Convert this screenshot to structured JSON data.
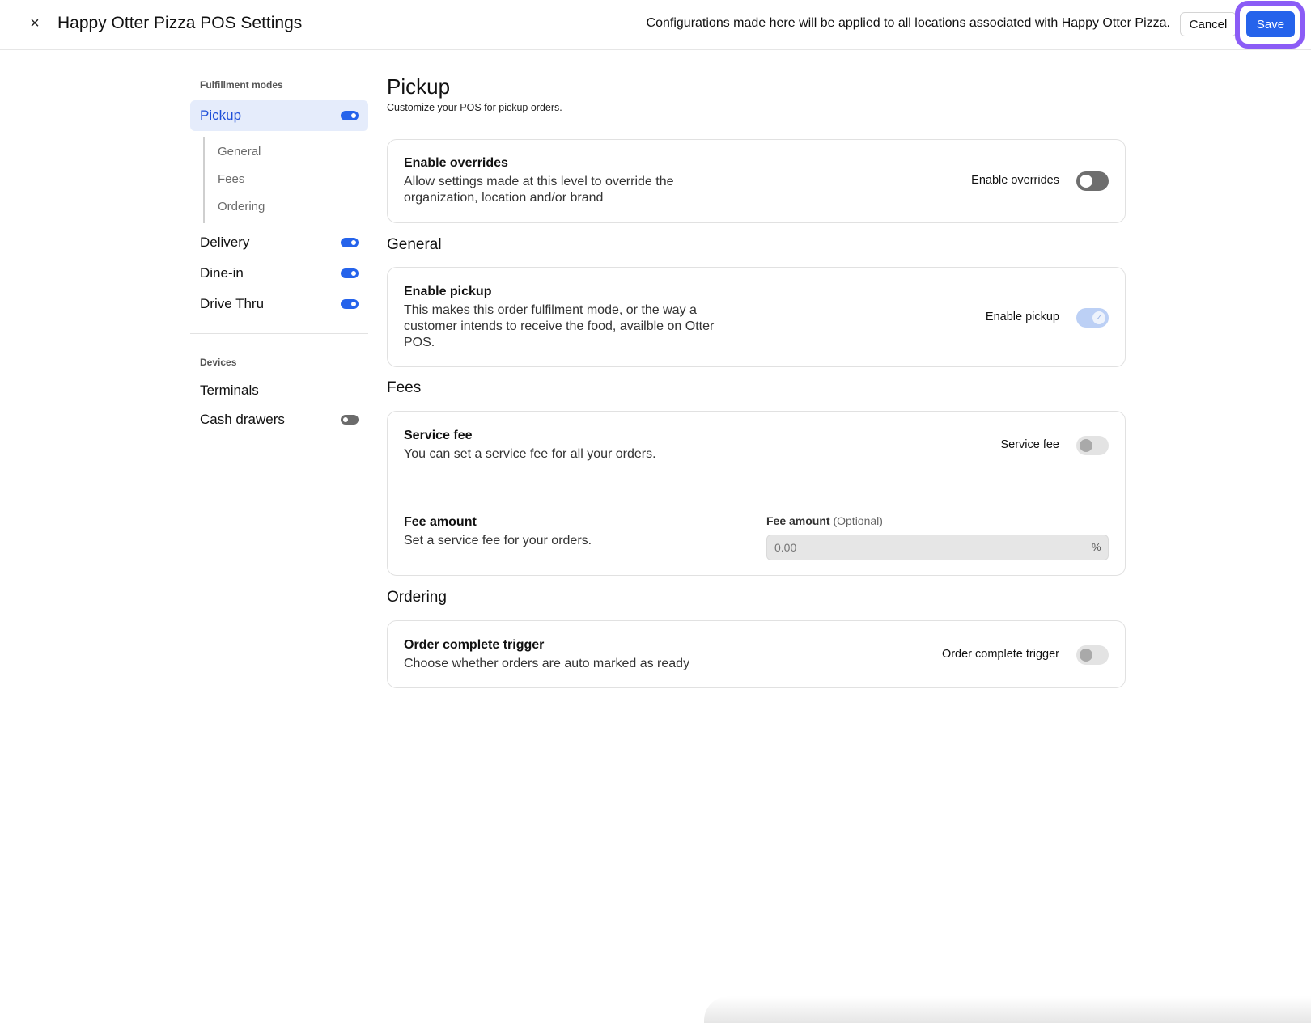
{
  "header": {
    "close_icon": "×",
    "title": "Happy Otter Pizza POS Settings",
    "notice": "Configurations made here will be applied to all locations associated with Happy Otter Pizza.",
    "cancel_label": "Cancel",
    "save_label": "Save"
  },
  "sidebar": {
    "fulfillment_label": "Fulfillment modes",
    "pickup": {
      "label": "Pickup",
      "enabled": true
    },
    "pickup_subitems": [
      "General",
      "Fees",
      "Ordering"
    ],
    "delivery": {
      "label": "Delivery",
      "enabled": true
    },
    "dine_in": {
      "label": "Dine-in",
      "enabled": true
    },
    "drive_thru": {
      "label": "Drive Thru",
      "enabled": true
    },
    "devices_label": "Devices",
    "terminals": {
      "label": "Terminals"
    },
    "cash_drawers": {
      "label": "Cash drawers",
      "enabled": false
    }
  },
  "main": {
    "title": "Pickup",
    "subtitle": "Customize your POS for pickup orders.",
    "overrides": {
      "title": "Enable overrides",
      "description": "Allow settings made at this level to override the organization, location and/or brand",
      "toggle_label": "Enable overrides",
      "enabled": false
    },
    "general": {
      "heading": "General",
      "enable_pickup": {
        "title": "Enable pickup",
        "description": "This makes this order fulfilment mode, or the way a customer intends to receive the food, availble on Otter POS.",
        "toggle_label": "Enable pickup",
        "enabled": true
      }
    },
    "fees": {
      "heading": "Fees",
      "service_fee": {
        "title": "Service fee",
        "description": "You can set a service fee for all your orders.",
        "toggle_label": "Service fee",
        "enabled": false
      },
      "fee_amount": {
        "title": "Fee amount",
        "description": "Set a service fee for your orders.",
        "field_label": "Fee amount",
        "field_optional": "(Optional)",
        "placeholder": "0.00",
        "suffix": "%"
      }
    },
    "ordering": {
      "heading": "Ordering",
      "order_complete": {
        "title": "Order complete trigger",
        "description": "Choose whether orders are auto marked as ready",
        "toggle_label": "Order complete trigger",
        "enabled": false
      }
    }
  }
}
